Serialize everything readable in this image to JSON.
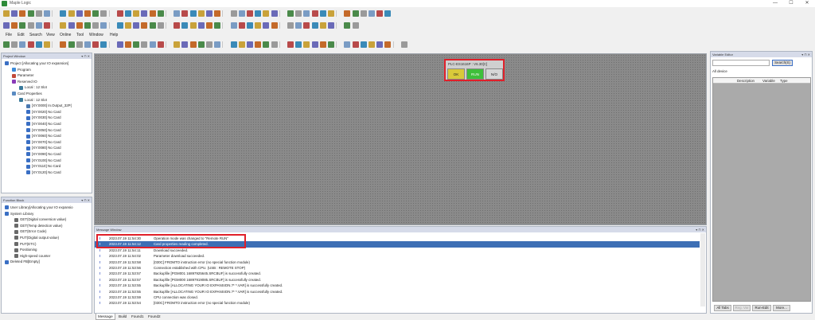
{
  "app": {
    "title": "Maple Logic",
    "min": "—",
    "max": "☐",
    "close": "✕"
  },
  "menu": [
    "File",
    "Edit",
    "Search",
    "View",
    "Online",
    "Tool",
    "Window",
    "Help"
  ],
  "project_window": {
    "title": "Project Window",
    "tree": [
      {
        "label": "Project [Allocating your IO expansion]",
        "level": 0,
        "icon": "project-icon"
      },
      {
        "label": "Program",
        "level": 1,
        "icon": "program-icon"
      },
      {
        "label": "Parameter",
        "level": 1,
        "icon": "parameter-icon"
      },
      {
        "label": "Reserved IO",
        "level": 1,
        "icon": "reserved-io-icon"
      },
      {
        "label": "Local : 12 Slot",
        "level": 2,
        "icon": "slot-icon"
      },
      {
        "label": "Card Properties",
        "level": 1,
        "icon": "card-properties-icon"
      },
      {
        "label": "Local : 12 Slot",
        "level": 2,
        "icon": "slot-icon"
      },
      {
        "label": "[XY:0000] In.Output_32P(",
        "level": 3,
        "icon": "card-icon"
      },
      {
        "label": "[XY:0020] No Card",
        "level": 3,
        "icon": "no-card-icon"
      },
      {
        "label": "[XY:0030] No Card",
        "level": 3,
        "icon": "no-card-icon"
      },
      {
        "label": "[XY:0040] No Card",
        "level": 3,
        "icon": "no-card-icon"
      },
      {
        "label": "[XY:0050] No Card",
        "level": 3,
        "icon": "no-card-icon"
      },
      {
        "label": "[XY:0060] No Card",
        "level": 3,
        "icon": "no-card-icon"
      },
      {
        "label": "[XY:0070] No Card",
        "level": 3,
        "icon": "no-card-icon"
      },
      {
        "label": "[XY:0080] No Card",
        "level": 3,
        "icon": "no-card-icon"
      },
      {
        "label": "[XY:0090] No Card",
        "level": 3,
        "icon": "no-card-icon"
      },
      {
        "label": "[XY:0100] No Card",
        "level": 3,
        "icon": "no-card-icon"
      },
      {
        "label": "[XY:0110] No Card",
        "level": 3,
        "icon": "no-card-icon"
      },
      {
        "label": "[XY:0120] No Card",
        "level": 3,
        "icon": "no-card-icon"
      }
    ]
  },
  "function_block": {
    "title": "Function Block",
    "tree": [
      {
        "label": "User Library[Allocating your IO expansio",
        "level": 0
      },
      {
        "label": "System Library",
        "level": 0
      },
      {
        "label": "GET(Digital conversion value)",
        "level": 1
      },
      {
        "label": "GET(Temp detection value)",
        "level": 1
      },
      {
        "label": "GET(Error Code)",
        "level": 1
      },
      {
        "label": "PUT(Digital output value)",
        "level": 1
      },
      {
        "label": "PUT(ETC)",
        "level": 1
      },
      {
        "label": "Positioning",
        "level": 1
      },
      {
        "label": "High-speed counter",
        "level": 1
      },
      {
        "label": "Deleted FB[Empty]",
        "level": 0
      }
    ]
  },
  "plc": {
    "label": "PLC-ES1616P : V6.30[C]",
    "status": [
      "OK",
      "RUN",
      "N/O"
    ]
  },
  "message_window": {
    "title": "Message Window",
    "rows": [
      {
        "time": "2023.07.19 11:54:30",
        "text": "Operation mode was changed to \"Remote RUN\""
      },
      {
        "time": "2023.07.19 11:54:12",
        "text": "Card properties reading completed."
      },
      {
        "time": "2023.07.19 11:54:11",
        "text": "Download succeeded."
      },
      {
        "time": "2023.07.19 11:54:02",
        "text": "Parameter download succeeded."
      },
      {
        "time": "2023.07.19 11:53:58",
        "text": "[030C] FROMTO instruction error (no special function module)"
      },
      {
        "time": "2023.07.19 11:53:56",
        "text": "Connection established with CPU. (USB : REMOTE STOP)"
      },
      {
        "time": "2023.07.19 11:53:57",
        "text": "Backupfile [PGM001 16897925645.SRCBUF] is successfully created."
      },
      {
        "time": "2023.07.19 11:53:57",
        "text": "Backupfile [PGM000 16897919085.SRCBUF] is successfully created."
      },
      {
        "time": "2023.07.19 11:53:55",
        "text": "Backupfile [ALLOCATING YOUR IO EXPANSION.?* *.VAR] is successfully created."
      },
      {
        "time": "2023.07.19 11:53:55",
        "text": "Backupfile [ALLOCATING YOUR IO EXPANSION.?* *.VAR] is successfully created."
      },
      {
        "time": "2023.07.19 11:53:59",
        "text": "CPU connection was closed."
      },
      {
        "time": "2023.07.19 11:53:54",
        "text": "[030C] FROMTO instruction error (no special function module)"
      }
    ],
    "selected_index": 1,
    "tabs": [
      "Message",
      "Build",
      "Found1",
      "Found2"
    ]
  },
  "variable_editor": {
    "title": "Variable Editor",
    "search_button": "Search(S)",
    "scope": "All device",
    "columns": [
      "Description",
      "Variable",
      "Type"
    ],
    "buttons": [
      "All Tabs",
      "Reg. Var",
      "Run-Edit",
      "More..."
    ]
  }
}
